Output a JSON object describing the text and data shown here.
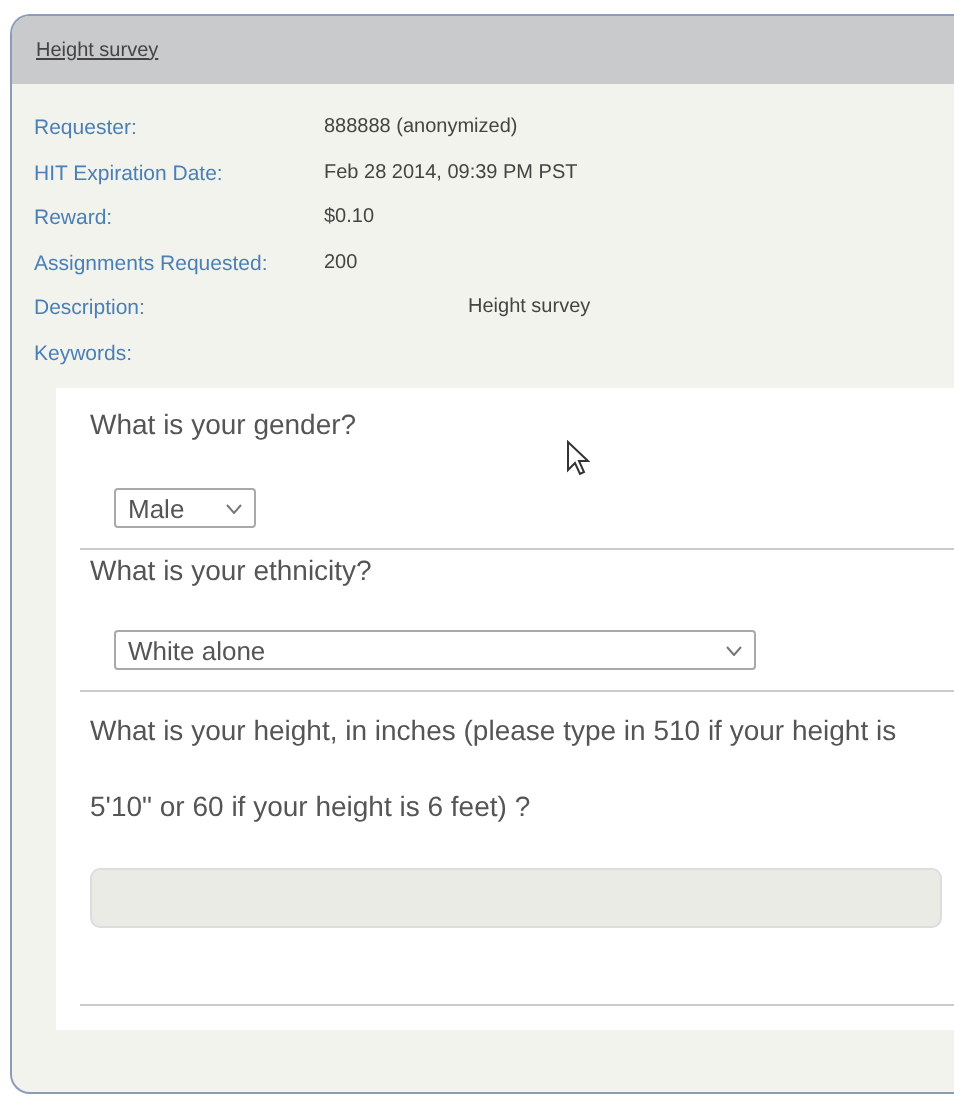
{
  "panel": {
    "title": "Height survey"
  },
  "details": [
    {
      "label": "Requester:",
      "value": "888888 (anonymized)",
      "kind": "plain"
    },
    {
      "label": "HIT Expiration Date:",
      "value": "Feb 28 2014, 09:39 PM PST",
      "kind": "plain"
    },
    {
      "label": "Reward:",
      "value": "$0.10",
      "kind": "plain"
    },
    {
      "label": "Assignments Requested:",
      "value": "200",
      "kind": "plain"
    },
    {
      "label": "Description:",
      "value": "Height survey",
      "kind": "indented"
    },
    {
      "label": "Keywords:"
    }
  ],
  "questions": [
    {
      "kind": "select",
      "prompt": "What is your gender?",
      "value": "Male",
      "wide": false
    },
    {
      "kind": "select",
      "prompt": "What is your ethnicity?",
      "value": "White alone",
      "wide": true
    },
    {
      "kind": "text",
      "prompt": "What is your height, in inches (please type in 510 if your height is 5'10\" or 60 if your height is 6 feet) ?"
    }
  ]
}
